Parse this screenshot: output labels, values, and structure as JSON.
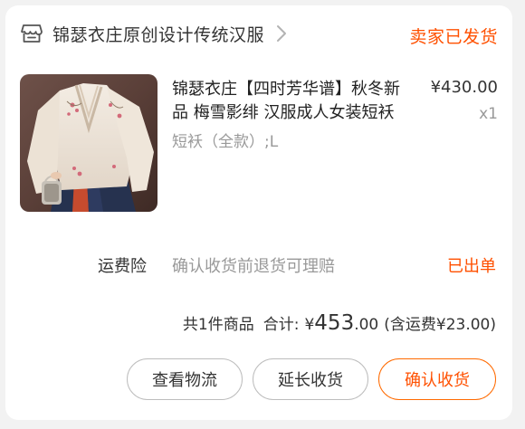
{
  "shop": {
    "icon": "store-icon",
    "name": "锦瑟衣庄原创设计传统汉服",
    "chevron": "chevron-right-icon",
    "status": "卖家已发货"
  },
  "product": {
    "image": "hanfu-product-photo",
    "title": "锦瑟衣庄【四时芳华谱】秋冬新品 梅雪影绯 汉服成人女装短袄",
    "sku": "短袄（全款）;L",
    "price": "¥430.00",
    "qty": "x1"
  },
  "insurance": {
    "label": "运费险",
    "desc": "确认收货前退货可理赔",
    "status": "已出单"
  },
  "totals": {
    "count": "共1件商品",
    "label": "合计:",
    "currency": "¥",
    "amount_int": "453",
    "amount_dec": ".00",
    "shipping": "(含运费¥23.00)"
  },
  "buttons": {
    "logistics": "查看物流",
    "extend": "延长收货",
    "confirm": "确认收货"
  },
  "colors": {
    "accent": "#ff5000",
    "muted": "#999999",
    "text": "#333333"
  }
}
